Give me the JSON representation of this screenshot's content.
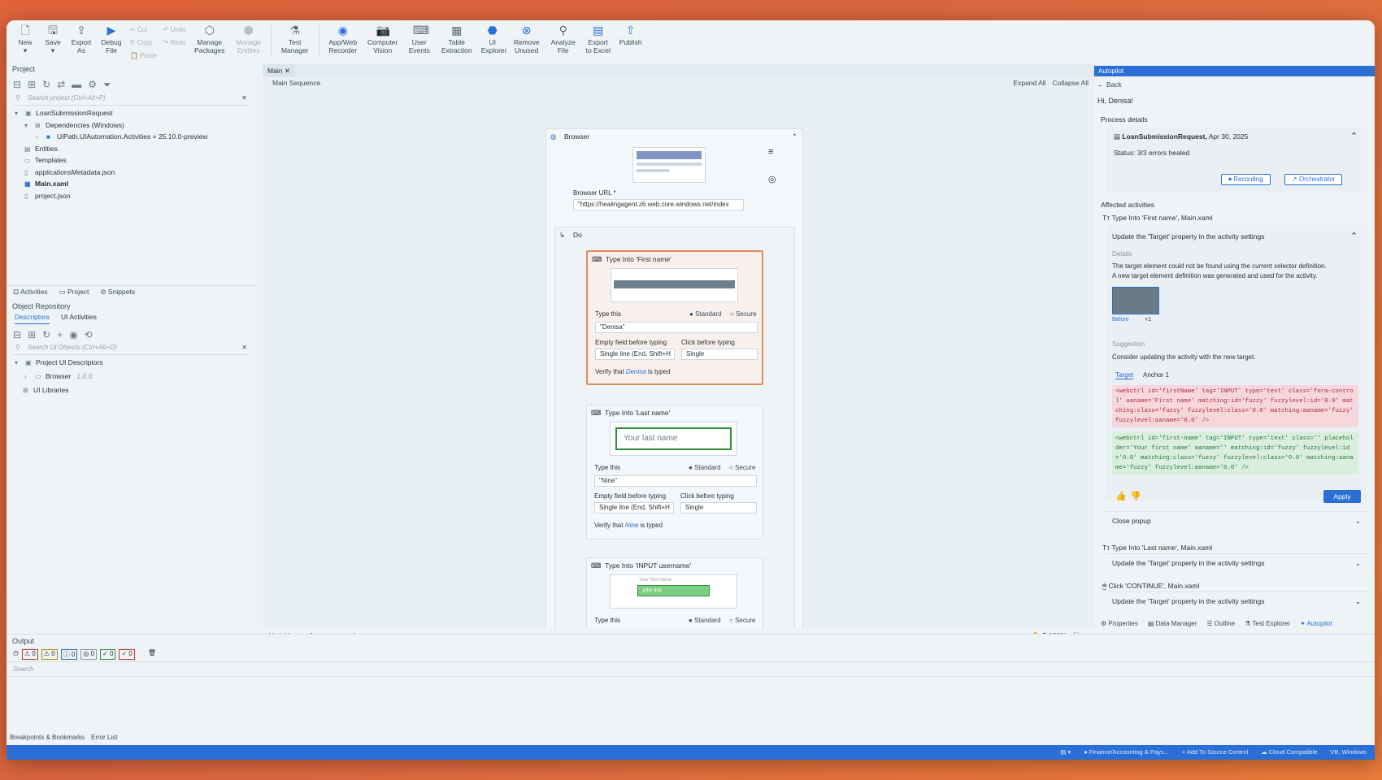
{
  "ribbon": {
    "new": "New",
    "save": "Save",
    "export_as": "Export As",
    "debug_file": "Debug File",
    "cut": "Cut",
    "copy": "Copy",
    "paste": "Paste",
    "undo": "Undo",
    "redo": "Redo",
    "manage_packages": "Manage Packages",
    "manage_entities": "Manage Entities",
    "test_manager": "Test Manager",
    "app_web_recorder": "App/Web Recorder",
    "computer_vision": "Computer Vision",
    "user_events": "User Events",
    "table_extraction": "Table Extraction",
    "ui_explorer": "UI Explorer",
    "remove_unused": "Remove Unused",
    "analyze_file": "Analyze File",
    "export_to_excel": "Export to Excel",
    "publish": "Publish"
  },
  "project": {
    "title": "Project",
    "search_placeholder": "Search project (Ctrl+Alt+P)",
    "items": [
      "LoanSubmissionRequest",
      "Dependencies (Windows)",
      "UiPath.UIAutomation.Activities = 25.10.0-preview",
      "Entities",
      "Templates",
      "applicationsMetadata.json",
      "Main.xaml",
      "project.json"
    ]
  },
  "left_tabs": {
    "activities": "Activities",
    "project": "Project",
    "snippets": "Snippets"
  },
  "object_repo": {
    "title": "Object Repository",
    "tab_descriptors": "Descriptors",
    "tab_ui_activities": "UI Activities",
    "search_placeholder": "Search UI Objects (Ctrl+Alt+O)",
    "items": [
      "Project UI Descriptors",
      "Browser",
      "UI Libraries"
    ],
    "browser_version": "1.0.0"
  },
  "designer": {
    "tab": "Main",
    "breadcrumb": "Main Sequence",
    "expand_all": "Expand All",
    "collapse_all": "Collapse All",
    "browser_title": "Browser",
    "browser_url_label": "Browser URL *",
    "browser_url": "\"https://healingagent.z6.web.core.windows.net/index",
    "do_title": "Do",
    "act1": {
      "title": "Type Into 'First name'",
      "type_this": "Type this",
      "standard": "Standard",
      "secure": "Secure",
      "value": "\"Denisa\"",
      "empty_field": "Empty field before typing",
      "click_before": "Click before typing",
      "empty_val": "Single line (End, Shift+H",
      "click_val": "Single",
      "verify_pre": "Verify that",
      "verify_val": "Denisa",
      "verify_post": "is typed"
    },
    "act2": {
      "title": "Type Into 'Last name'",
      "placeholder": "Your last name",
      "type_this": "Type this",
      "standard": "Standard",
      "secure": "Secure",
      "value": "\"Nine\"",
      "empty_field": "Empty field before typing",
      "click_before": "Click before typing",
      "empty_val": "Single line (End, Shift+H",
      "click_val": "Single",
      "verify_pre": "Verify that",
      "verify_val": "Nine",
      "verify_post": "is typed"
    },
    "act3": {
      "title": "Type Into 'INPUT username'",
      "thumb_label": "Your first name",
      "thumb_value": "john doe",
      "type_this": "Type this",
      "standard": "Standard",
      "secure": "Secure"
    },
    "bottom_tabs": {
      "variables": "Variables",
      "arguments": "Arguments",
      "imports": "Imports"
    },
    "zoom": "100%"
  },
  "autopilot": {
    "title": "Autopilot",
    "back": "Back",
    "greeting": "Hi, Denisa!",
    "process_details": "Process details",
    "process_name": "LoanSubmissionRequest,",
    "process_date": "Apr 30, 2025",
    "status": "Status: 3/3 errors healed",
    "recording": "Recording",
    "orchestrator": "Orchestrator",
    "affected": "Affected activities",
    "act1": "Type Into 'First name', Main.xaml",
    "update_target": "Update the 'Target' property in the activity settings",
    "details_label": "Details",
    "details_text1": "The target element could not be found using the current selector definition.",
    "details_text2": "A new target element definition was generated and used for the activity.",
    "before": "Before",
    "plus": "+1",
    "suggestion_label": "Suggestion",
    "suggestion_text": "Consider updating the activity with the new target.",
    "tab_target": "Target",
    "tab_anchor": "Anchor 1",
    "code_old": "<webctrl id='firstName' tag='INPUT' type='text' class='form-control' aaname='First name' matching:id='fuzzy' fuzzylevel:id='0.0' matching:class='fuzzy' fuzzylevel:class='0.0' matching:aaname='fuzzy' fuzzylevel:aaname='0.0' />",
    "code_new": "<webctrl id='first-name' tag='INPUT' type='text' class='' placeholder='Your first name' aaname='' matching:id='fuzzy' fuzzylevel:id='0.0' matching:class='fuzzy' fuzzylevel:class='0.0' matching:aaname='fuzzy' fuzzylevel:aaname='0.0' />",
    "apply": "Apply",
    "close_popup": "Close popup",
    "act2": "Type Into 'Last name', Main.xaml",
    "update_target2": "Update the 'Target' property in the activity settings",
    "act3": "Click 'CONTINUE', Main.xaml",
    "update_target3": "Update the 'Target' property in the activity settings"
  },
  "right_tabs": {
    "properties": "Properties",
    "data_manager": "Data Manager",
    "outline": "Outline",
    "test_explorer": "Test Explorer",
    "autopilot": "Autopilot"
  },
  "output": {
    "title": "Output",
    "search": "Search",
    "counts": [
      "0",
      "0",
      "0",
      "0",
      "0",
      "0"
    ]
  },
  "bottom": {
    "breakpoints": "Breakpoints & Bookmarks",
    "error_list": "Error List"
  },
  "status": {
    "finance": "Finance/Accounting & Pays...",
    "source_control": "Add To Source Control",
    "cloud": "Cloud Compatible",
    "platform": "VB, Windows"
  }
}
